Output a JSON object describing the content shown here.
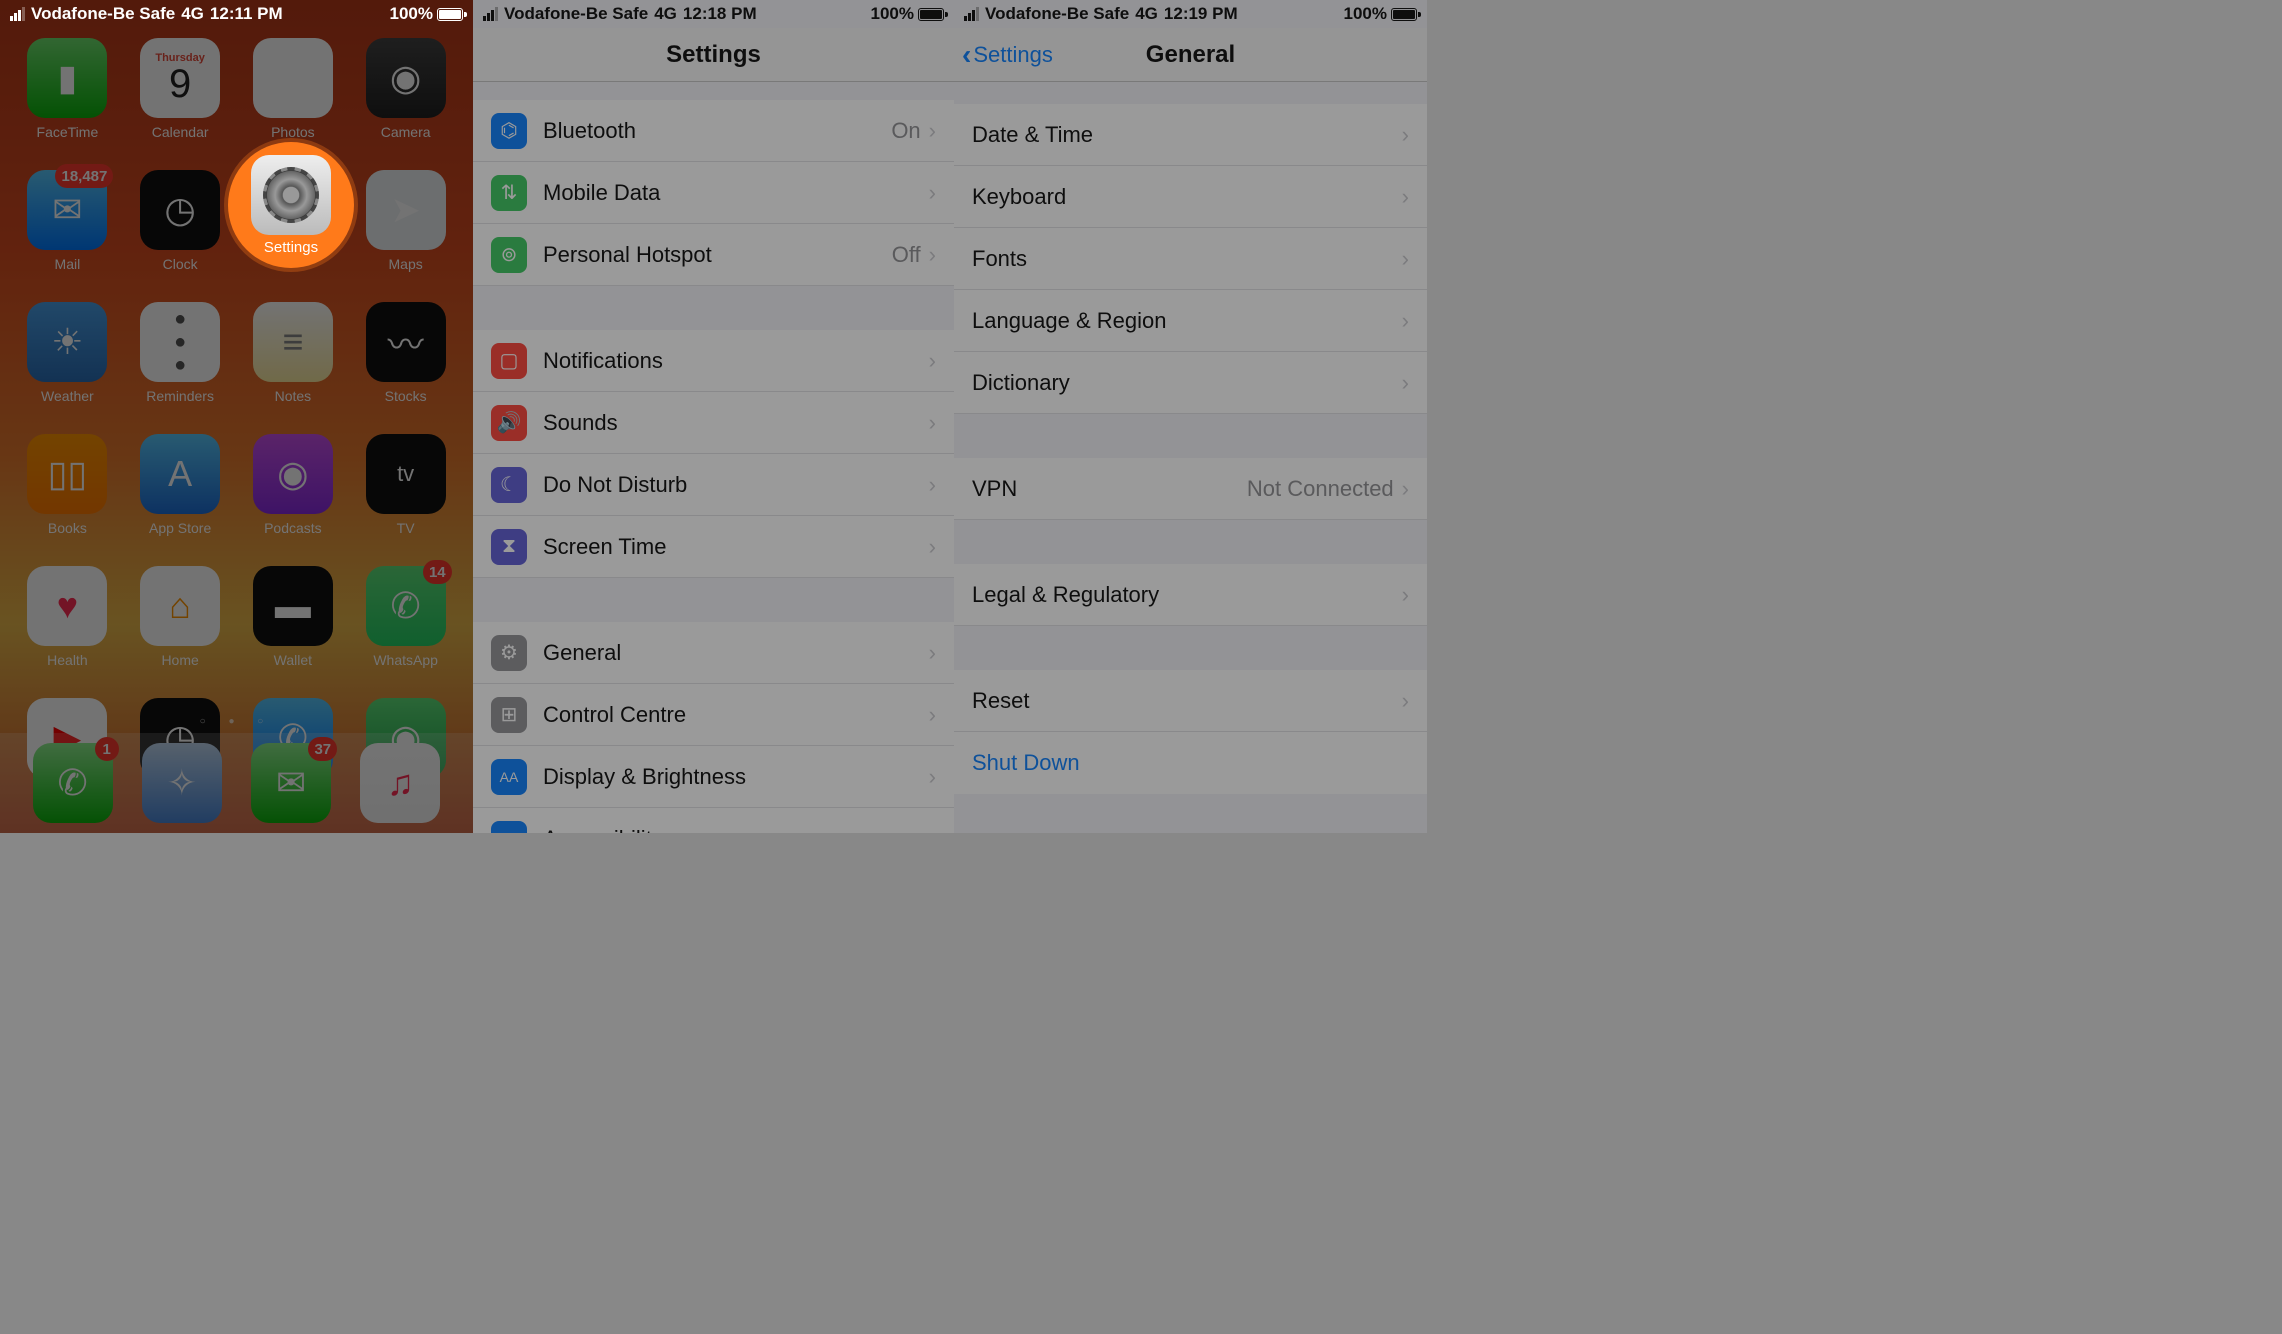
{
  "screen1": {
    "status": {
      "carrier": "Vodafone-Be Safe",
      "net": "4G",
      "time": "12:11 PM",
      "battery": "100%"
    },
    "highlight": {
      "label": "Settings"
    },
    "apps": {
      "row1": [
        {
          "name": "FaceTime",
          "badge": ""
        },
        {
          "name": "Calendar",
          "day": "Thursday",
          "date": "9"
        },
        {
          "name": "Photos"
        },
        {
          "name": "Camera"
        }
      ],
      "row2": [
        {
          "name": "Mail",
          "badge": "18,487"
        },
        {
          "name": "Clock"
        },
        {
          "name": "Settings"
        },
        {
          "name": "Maps"
        }
      ],
      "row3": [
        {
          "name": "Weather"
        },
        {
          "name": "Reminders"
        },
        {
          "name": "Notes"
        },
        {
          "name": "Stocks"
        }
      ],
      "row4": [
        {
          "name": "Books"
        },
        {
          "name": "App Store"
        },
        {
          "name": "Podcasts"
        },
        {
          "name": "TV"
        }
      ],
      "row5": [
        {
          "name": "Health"
        },
        {
          "name": "Home"
        },
        {
          "name": "Wallet"
        },
        {
          "name": "WhatsApp",
          "badge": "14"
        }
      ],
      "row6": [
        {
          "name": "YouTube"
        },
        {
          "name": "Watch"
        },
        {
          "name": "Truecaller"
        },
        {
          "name": "Find My"
        }
      ]
    },
    "dock": [
      {
        "name": "Phone",
        "badge": "1"
      },
      {
        "name": "Safari"
      },
      {
        "name": "Messages",
        "badge": "37"
      },
      {
        "name": "Music"
      }
    ]
  },
  "screen2": {
    "status": {
      "carrier": "Vodafone-Be Safe",
      "net": "4G",
      "time": "12:18 PM",
      "battery": "100%"
    },
    "title": "Settings",
    "rows": {
      "bluetooth": {
        "label": "Bluetooth",
        "value": "On"
      },
      "mobile": {
        "label": "Mobile Data"
      },
      "hotspot": {
        "label": "Personal Hotspot",
        "value": "Off"
      },
      "notif": {
        "label": "Notifications"
      },
      "sounds": {
        "label": "Sounds"
      },
      "dnd": {
        "label": "Do Not Disturb"
      },
      "screentime": {
        "label": "Screen Time"
      },
      "general": {
        "label": "General"
      },
      "control": {
        "label": "Control Centre"
      },
      "display": {
        "label": "Display & Brightness"
      },
      "access": {
        "label": "Accessibility"
      }
    }
  },
  "screen3": {
    "status": {
      "carrier": "Vodafone-Be Safe",
      "net": "4G",
      "time": "12:19 PM",
      "battery": "100%"
    },
    "back": "Settings",
    "title": "General",
    "rows": {
      "datetime": {
        "label": "Date & Time"
      },
      "keyboard": {
        "label": "Keyboard"
      },
      "fonts": {
        "label": "Fonts"
      },
      "lang": {
        "label": "Language & Region"
      },
      "dict": {
        "label": "Dictionary"
      },
      "vpn": {
        "label": "VPN",
        "value": "Not Connected"
      },
      "legal": {
        "label": "Legal & Regulatory"
      },
      "reset": {
        "label": "Reset"
      },
      "shutdown": {
        "label": "Shut Down"
      }
    }
  }
}
